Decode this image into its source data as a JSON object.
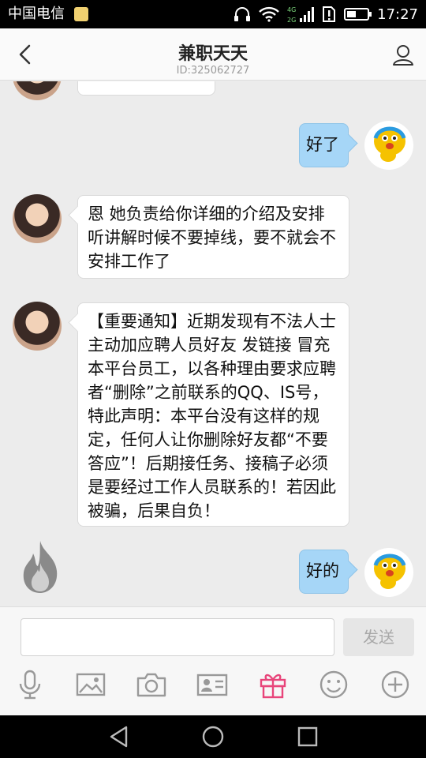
{
  "status_bar": {
    "carrier": "中国电信",
    "network": "4G 2G",
    "time": "17:27"
  },
  "header": {
    "back_icon": "chevron-left-icon",
    "title": "兼职天天",
    "subtitle": "ID:325062727",
    "profile_icon": "person-icon"
  },
  "messages": [
    {
      "side": "right",
      "text": "好了"
    },
    {
      "side": "left",
      "text": "恩 她负责给你详细的介绍及安排听讲解时候不要掉线，要不就会不安排工作了"
    },
    {
      "side": "left",
      "text": "【重要通知】近期发现有不法人士主动加应聘人员好友 发链接 冒充本平台员工，以各种理由要求应聘者“删除”之前联系的QQ、IS号，特此声明：本平台没有这样的规定，任何人让你删除好友都“不要答应”！后期接任务、接稿子必须是要经过工作人员联系的！若因此被骗，后果自负！"
    },
    {
      "side": "right",
      "text": "好的"
    }
  ],
  "input": {
    "placeholder": "",
    "send_label": "发送"
  },
  "toolbar": [
    "microphone-icon",
    "image-icon",
    "camera-icon",
    "contact-card-icon",
    "gift-icon",
    "emoji-icon",
    "plus-icon"
  ],
  "colors": {
    "outgoing_bubble": "#a6d6f7",
    "gift_accent": "#e8457a"
  }
}
